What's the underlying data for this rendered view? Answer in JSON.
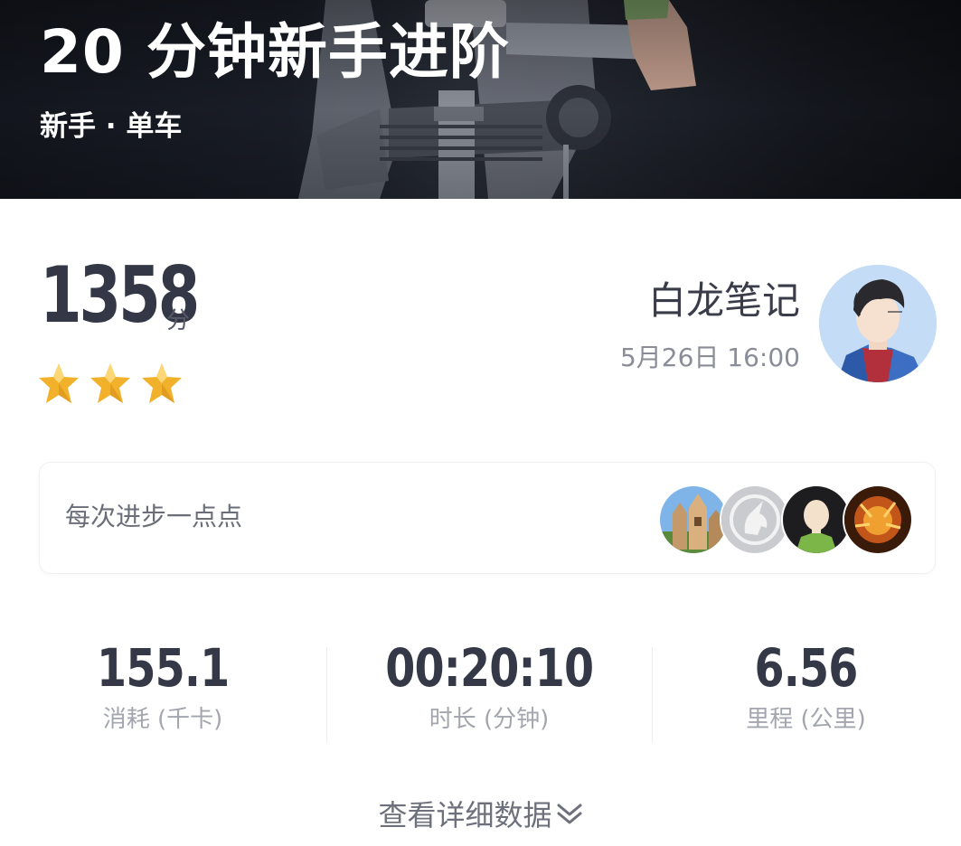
{
  "hero": {
    "title": "20 分钟新手进阶",
    "subtitle": "新手 · 单车"
  },
  "score": {
    "value": "1358",
    "unit": "分",
    "stars_filled": 3,
    "stars_total": 3,
    "star_color": "#f2b12a"
  },
  "user": {
    "name": "白龙笔记",
    "datetime": "5月26日 16:00"
  },
  "motto": {
    "text": "每次进步一点点",
    "liker_avatars": [
      "castle-avatar",
      "unicorn-avatar",
      "bald-hero-avatar",
      "fire-lion-avatar"
    ]
  },
  "stats": [
    {
      "value": "155.1",
      "label": "消耗 (千卡)"
    },
    {
      "value": "00:20:10",
      "label": "时长 (分钟)"
    },
    {
      "value": "6.56",
      "label": "里程 (公里)"
    }
  ],
  "more": {
    "label": "查看详细数据",
    "icon": "double-chevron-down-icon"
  }
}
